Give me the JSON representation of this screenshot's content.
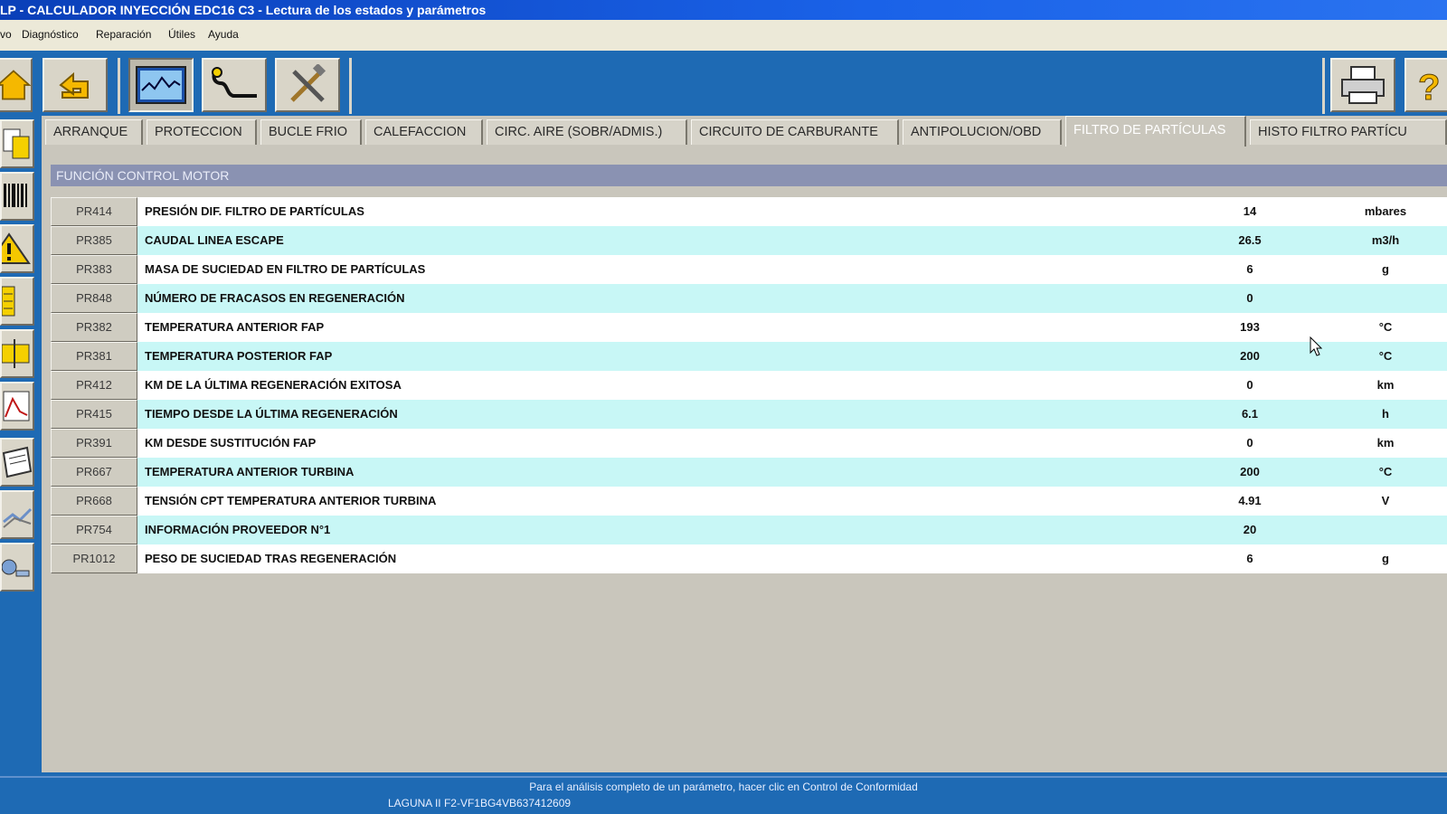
{
  "window": {
    "title": "LP - CALCULADOR INYECCIÓN EDC16 C3 - Lectura de los estados y parámetros"
  },
  "menu": {
    "items": [
      "vo",
      "Diagnóstico",
      "Reparación",
      "Útiles",
      "Ayuda"
    ]
  },
  "toolbar": {
    "icons": [
      "home-icon",
      "back-icon",
      "monitor-icon",
      "probe-icon",
      "tools-icon",
      "printer-icon",
      "help-icon"
    ]
  },
  "sidebar": {
    "icons": [
      "documents-icon",
      "barcode-icon",
      "warning-icon",
      "list-icon",
      "folder-icon",
      "chart-icon",
      "book-icon",
      "graph-icon",
      "settings-icon"
    ]
  },
  "tabs": [
    "ARRANQUE",
    "PROTECCION",
    "BUCLE FRIO",
    "CALEFACCION",
    "CIRC. AIRE (SOBR/ADMIS.)",
    "CIRCUITO DE CARBURANTE",
    "ANTIPOLUCION/OBD",
    "FILTRO DE PARTÍCULAS",
    "HISTO FILTRO PARTÍCU"
  ],
  "active_tab": "FILTRO DE PARTÍCULAS",
  "section": {
    "title": "FUNCIÓN CONTROL MOTOR"
  },
  "rows": [
    {
      "code": "PR414",
      "label": "PRESIÓN DIF. FILTRO DE PARTÍCULAS",
      "value": "14",
      "unit": "mbares"
    },
    {
      "code": "PR385",
      "label": "CAUDAL LINEA ESCAPE",
      "value": "26.5",
      "unit": "m3/h"
    },
    {
      "code": "PR383",
      "label": "MASA DE SUCIEDAD EN FILTRO DE PARTÍCULAS",
      "value": "6",
      "unit": "g"
    },
    {
      "code": "PR848",
      "label": "NÚMERO DE FRACASOS EN REGENERACIÓN",
      "value": "0",
      "unit": ""
    },
    {
      "code": "PR382",
      "label": "TEMPERATURA ANTERIOR FAP",
      "value": "193",
      "unit": "°C"
    },
    {
      "code": "PR381",
      "label": "TEMPERATURA POSTERIOR FAP",
      "value": "200",
      "unit": "°C"
    },
    {
      "code": "PR412",
      "label": "KM DE LA ÚLTIMA REGENERACIÓN EXITOSA",
      "value": "0",
      "unit": "km"
    },
    {
      "code": "PR415",
      "label": "TIEMPO DESDE LA ÚLTIMA REGENERACIÓN",
      "value": "6.1",
      "unit": "h"
    },
    {
      "code": "PR391",
      "label": "KM DESDE SUSTITUCIÓN FAP",
      "value": "0",
      "unit": "km"
    },
    {
      "code": "PR667",
      "label": "TEMPERATURA ANTERIOR TURBINA",
      "value": "200",
      "unit": "°C"
    },
    {
      "code": "PR668",
      "label": "TENSIÓN CPT TEMPERATURA ANTERIOR TURBINA",
      "value": "4.91",
      "unit": "V"
    },
    {
      "code": "PR754",
      "label": "INFORMACIÓN PROVEEDOR N°1",
      "value": "20",
      "unit": ""
    },
    {
      "code": "PR1012",
      "label": "PESO DE SUCIEDAD TRAS REGENERACIÓN",
      "value": "6",
      "unit": "g"
    }
  ],
  "status": {
    "hint": "Para el análisis completo de un parámetro, hacer clic en Control de Conformidad",
    "vehicle": "LAGUNA II F2-VF1BG4VB637412609"
  },
  "colors": {
    "frame_blue": "#1e6ab4",
    "row_cyan": "#c8f7f6",
    "header_bar": "#8a92b2"
  }
}
